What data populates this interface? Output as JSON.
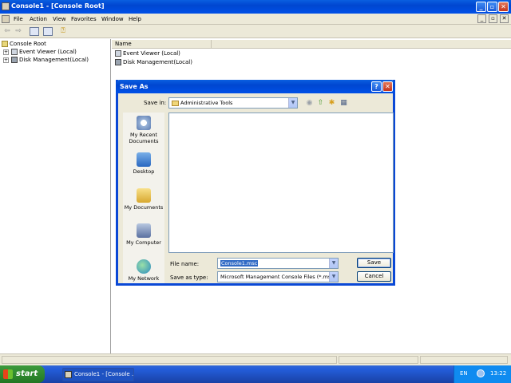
{
  "window": {
    "title": "Console1 - [Console Root]"
  },
  "menu": {
    "items": [
      "File",
      "Action",
      "View",
      "Favorites",
      "Window",
      "Help"
    ]
  },
  "toolbar": {
    "icons": [
      "back-icon",
      "forward-icon",
      "show-hide-tree-icon",
      "export-list-icon",
      "help-icon"
    ]
  },
  "tree": {
    "root": "Console Root",
    "items": [
      "Event Viewer (Local)",
      "Disk Management(Local)"
    ]
  },
  "list": {
    "column": "Name",
    "items": [
      "Event Viewer (Local)",
      "Disk Management(Local)"
    ]
  },
  "dialog": {
    "title": "Save As",
    "save_in_label": "Save in:",
    "save_in_value": "Administrative Tools",
    "places": [
      "My Recent Documents",
      "Desktop",
      "My Documents",
      "My Computer",
      "My Network"
    ],
    "file_name_label": "File name:",
    "file_name_value": "Console1.msc",
    "save_type_label": "Save as type:",
    "save_type_value": "Microsoft Management Console Files (*.msc)",
    "save_button": "Save",
    "cancel_button": "Cancel",
    "help_glyph": "?",
    "close_glyph": "✕"
  },
  "taskbar": {
    "start_label": "start",
    "task_label": "Console1 - [Console ...",
    "language": "EN",
    "clock": "13:22"
  },
  "colors": {
    "title_blue": "#0a5fe0",
    "taskbar_blue": "#245edb",
    "start_green": "#2f8a2f",
    "tray_blue": "#0f8bf0",
    "selection": "#316ac5"
  }
}
